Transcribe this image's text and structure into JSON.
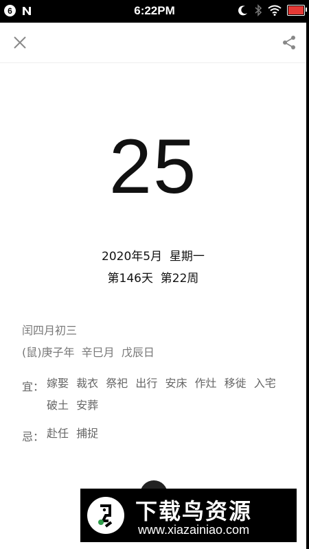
{
  "status_bar": {
    "notification_count": "6",
    "time": "6:22PM",
    "icons": [
      "n-icon",
      "moon-icon",
      "bluetooth-icon",
      "wifi-icon",
      "battery-icon"
    ],
    "battery_color": "#e53935"
  },
  "toolbar": {
    "close_icon": "close-icon",
    "share_icon": "share-icon"
  },
  "date": {
    "day": "25",
    "year_month_weekday": "2020年5月  星期一",
    "day_week_of_year": "第146天  第22周"
  },
  "lunar": {
    "lunar_date": "闰四月初三",
    "ganzhi": "(鼠)庚子年  辛巳月  戊辰日"
  },
  "yi": {
    "label": "宜：",
    "items": [
      "嫁娶",
      "裁衣",
      "祭祀",
      "出行",
      "安床",
      "作灶",
      "移徙",
      "入宅",
      "破土",
      "安葬"
    ]
  },
  "ji": {
    "label": "忌：",
    "items": [
      "赴任",
      "捕捉"
    ]
  },
  "watermark": {
    "title": "下载鸟资源",
    "url": "www.xiazainiao.com"
  }
}
